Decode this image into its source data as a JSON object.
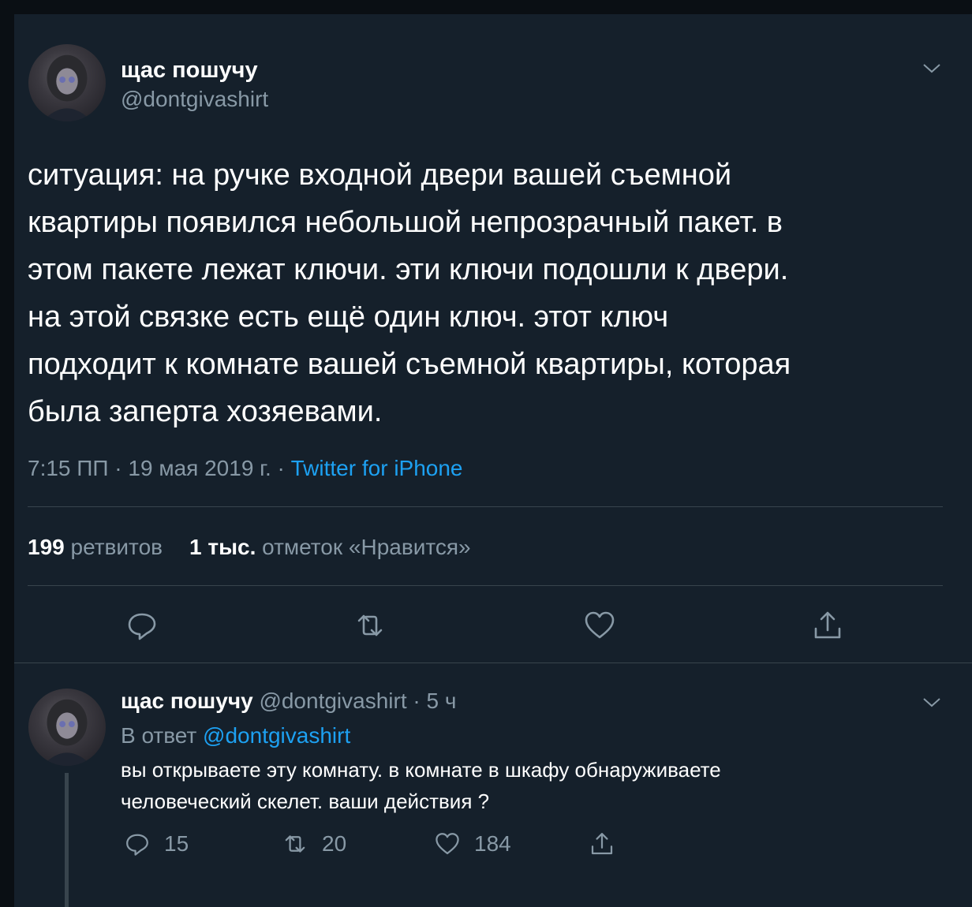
{
  "tweet": {
    "author_name": "щас пошучу",
    "author_handle": "@dontgivashirt",
    "text": "ситуация: на ручке входной двери вашей съемной\nквартиры  появился небольшой непрозрачный пакет. в\nэтом пакете лежат ключи. эти ключи подошли к двери.\nна этой связке есть ещё один ключ. этот ключ\nподходит к комнате вашей съемной квартиры, которая\nбыла заперта хозяевами.",
    "timestamp": "7:15 ПП · 19 мая 2019 г. · ",
    "source": "Twitter for iPhone",
    "retweets_count": "199",
    "retweets_label": "ретвитов",
    "likes_count": "1 тыс.",
    "likes_label": "отметок «Нравится»",
    "actions": [
      "reply-icon",
      "retweet-icon",
      "like-icon",
      "share-icon"
    ]
  },
  "reply": {
    "author_name": "щас пошучу",
    "author_handle": "@dontgivashirt",
    "time": "· 5 ч",
    "reply_to_prefix": "В ответ",
    "reply_to_handle": "@dontgivashirt",
    "text": "вы открываете эту комнату. в комнате в шкафу обнаруживаете\nчеловеческий скелет. ваши действия ?",
    "replies": "15",
    "retweets": "20",
    "likes": "184"
  },
  "colors": {
    "background": "#15202b",
    "text": "#ffffff",
    "secondary": "#8899a6",
    "accent": "#1da1f2",
    "divider": "#38444d"
  }
}
